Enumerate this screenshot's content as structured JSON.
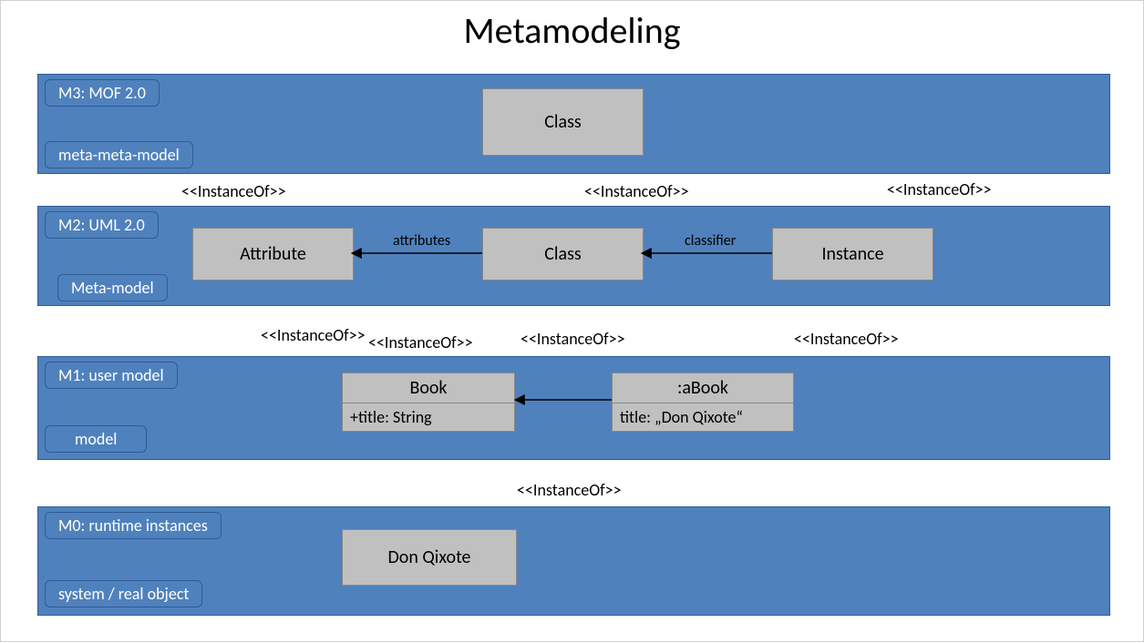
{
  "title": "Metamodeling",
  "stereotype": "<<InstanceOf>>",
  "layers": {
    "m3": {
      "level": "M3: MOF 2.0",
      "role": "meta-meta-model",
      "nodes": {
        "class": "Class"
      }
    },
    "m2": {
      "level": "M2: UML 2.0",
      "role": "Meta-model",
      "nodes": {
        "attribute": "Attribute",
        "class": "Class",
        "instance": "Instance"
      },
      "edges": {
        "attributes": "attributes",
        "classifier": "classifier"
      }
    },
    "m1": {
      "level": "M1: user model",
      "role": "model",
      "book": {
        "name": "Book",
        "attr": "+title: String"
      },
      "abook": {
        "name": ":aBook",
        "slot": "title: „Don Qixote“"
      }
    },
    "m0": {
      "level": "M0: runtime instances",
      "role": "system / real object",
      "nodes": {
        "object": "Don Qixote"
      }
    }
  }
}
